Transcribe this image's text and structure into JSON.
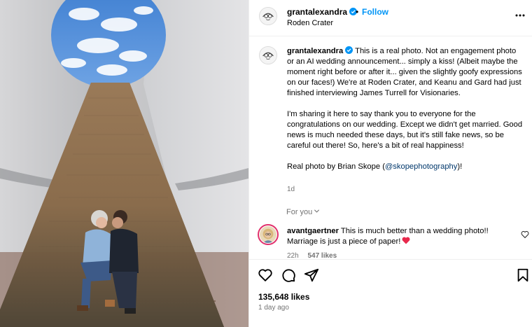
{
  "post": {
    "username": "grantalexandra",
    "follow_label": "Follow",
    "separator": "•",
    "location": "Roden Crater"
  },
  "caption": {
    "username": "grantalexandra",
    "paragraph1": "This is a real photo. Not an engagement photo or an AI wedding announcement... simply a kiss! (Albeit maybe the moment right before or after it... given the slightly goofy expressions on our faces!) We're at Roden Crater, and Keanu and Gard had just finished interviewing James Turrell for Visionaries.",
    "paragraph2": "I'm sharing it here to say thank you to everyone for the congratulations on our wedding. Except we didn't get married. Good news is much needed these days, but it's still fake news, so be careful out there! So, here's a bit of real happiness!",
    "paragraph3_prefix": "Real photo by Brian Skope (",
    "mention": "@skopephotography",
    "paragraph3_suffix": ")!",
    "time": "1d"
  },
  "for_you_label": "For you",
  "comment": {
    "username": "avantgaertner",
    "text": "This is much better than a wedding photo!! Marriage is just a piece of paper!",
    "time": "22h",
    "likes": "547 likes"
  },
  "stats": {
    "likes": "135,648 likes",
    "date": "1 day ago"
  },
  "icons": {
    "verified": "verified-badge-icon",
    "more": "more-options-icon",
    "like": "heart-icon",
    "comment": "comment-icon",
    "share": "share-icon",
    "save": "bookmark-icon",
    "emoji": "red-heart-emoji"
  },
  "colors": {
    "accent": "#0095f6",
    "mention": "#00376b",
    "muted": "#737373",
    "story_ring": "#e1306c"
  }
}
